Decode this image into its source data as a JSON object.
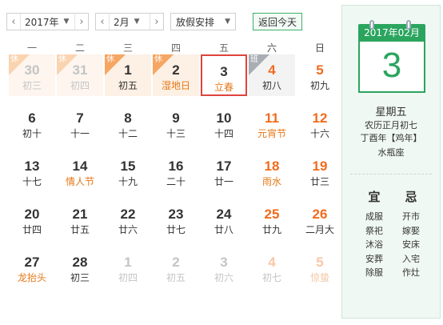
{
  "toolbar": {
    "year": "2017年",
    "month": "2月",
    "holiday": "放假安排",
    "today": "返回今天"
  },
  "weekdays": [
    "一",
    "二",
    "三",
    "四",
    "五",
    "六",
    "日"
  ],
  "tags": {
    "rest": "休",
    "work": "班"
  },
  "days": [
    {
      "d": "30",
      "l": "初三",
      "other": true,
      "rest": true
    },
    {
      "d": "31",
      "l": "初四",
      "other": true,
      "rest": true
    },
    {
      "d": "1",
      "l": "初五",
      "rest": true
    },
    {
      "d": "2",
      "l": "湿地日",
      "rest": true,
      "fest": true
    },
    {
      "d": "3",
      "l": "立春",
      "fest": true,
      "sel": true
    },
    {
      "d": "4",
      "l": "初八",
      "work": true,
      "wkend": true
    },
    {
      "d": "5",
      "l": "初九",
      "wkend": true
    },
    {
      "d": "6",
      "l": "初十"
    },
    {
      "d": "7",
      "l": "十一"
    },
    {
      "d": "8",
      "l": "十二"
    },
    {
      "d": "9",
      "l": "十三"
    },
    {
      "d": "10",
      "l": "十四"
    },
    {
      "d": "11",
      "l": "元宵节",
      "wkend": true,
      "fest": true
    },
    {
      "d": "12",
      "l": "十六",
      "wkend": true
    },
    {
      "d": "13",
      "l": "十七"
    },
    {
      "d": "14",
      "l": "情人节",
      "fest": true
    },
    {
      "d": "15",
      "l": "十九"
    },
    {
      "d": "16",
      "l": "二十"
    },
    {
      "d": "17",
      "l": "廿一"
    },
    {
      "d": "18",
      "l": "雨水",
      "wkend": true,
      "fest": true
    },
    {
      "d": "19",
      "l": "廿三",
      "wkend": true
    },
    {
      "d": "20",
      "l": "廿四"
    },
    {
      "d": "21",
      "l": "廿五"
    },
    {
      "d": "22",
      "l": "廿六"
    },
    {
      "d": "23",
      "l": "廿七"
    },
    {
      "d": "24",
      "l": "廿八"
    },
    {
      "d": "25",
      "l": "廿九",
      "wkend": true
    },
    {
      "d": "26",
      "l": "二月大",
      "wkend": true
    },
    {
      "d": "27",
      "l": "龙抬头",
      "fest": true
    },
    {
      "d": "28",
      "l": "初三"
    },
    {
      "d": "1",
      "l": "初四",
      "other": true
    },
    {
      "d": "2",
      "l": "初五",
      "other": true
    },
    {
      "d": "3",
      "l": "初六",
      "other": true
    },
    {
      "d": "4",
      "l": "初七",
      "other": true,
      "wkend": true
    },
    {
      "d": "5",
      "l": "惊蛰",
      "other": true,
      "wkend": true,
      "fest": true
    }
  ],
  "panel": {
    "header": "2017年02月",
    "day": "3",
    "weekday": "星期五",
    "lunar": "农历正月初七",
    "ganzhi": "丁酉年【鸡年】",
    "star": "水瓶座",
    "yi_title": "宜",
    "ji_title": "忌",
    "yi": [
      "成服",
      "祭祀",
      "沐浴",
      "安葬",
      "除服"
    ],
    "ji": [
      "开市",
      "嫁娶",
      "安床",
      "入宅",
      "作灶"
    ]
  },
  "colors": {
    "accent_green": "#2ba55e",
    "weekend_orange": "#f26b1d",
    "selected_red": "#e0433d"
  }
}
